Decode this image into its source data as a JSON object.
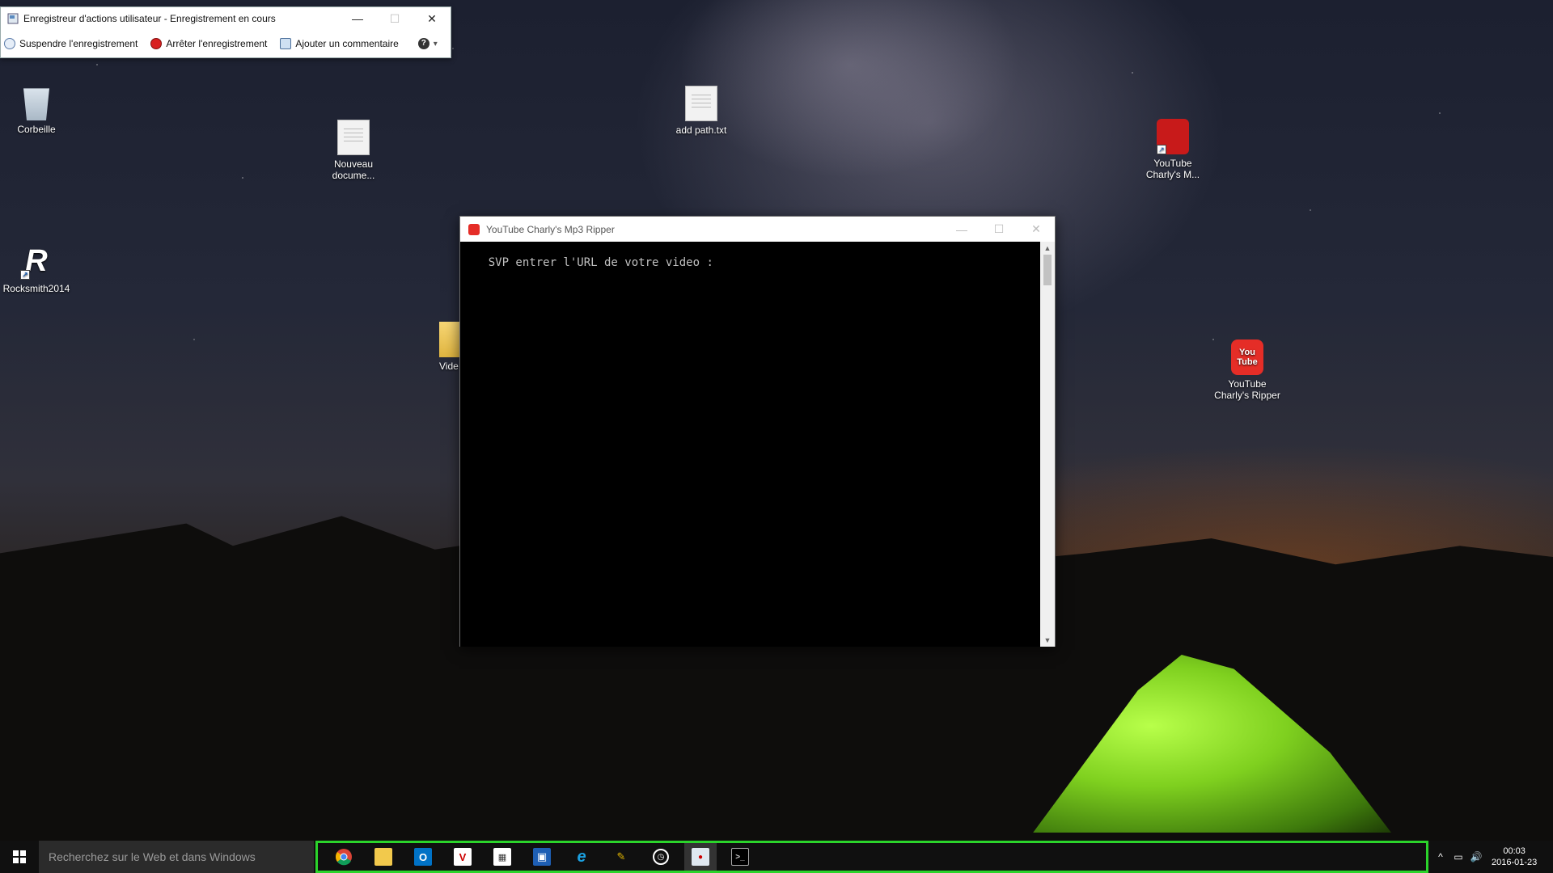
{
  "psr": {
    "title": "Enregistreur d'actions utilisateur - Enregistrement en cours",
    "pause_label": "Suspendre l'enregistrement",
    "stop_label": "Arrêter l'enregistrement",
    "comment_label": "Ajouter un commentaire",
    "help_glyph": "?",
    "dropdown_glyph": "▾"
  },
  "desktop": {
    "recycle_bin": "Corbeille",
    "new_doc": "Nouveau docume...",
    "add_path": "add path.txt",
    "yt_mp3": "YouTube Charly's M...",
    "rocksmith": "Rocksmith2014",
    "video_folder": "Vide",
    "yt_ripper": "YouTube Charly's Ripper",
    "yt_logo_text": "You Tube",
    "shortcut_glyph": "↗"
  },
  "console": {
    "title": "YouTube Charly's Mp3 Ripper",
    "prompt": "SVP entrer l'URL de votre video :"
  },
  "window_controls": {
    "minimize": "—",
    "maximize": "☐",
    "close": "✕"
  },
  "taskbar": {
    "search_placeholder": "Recherchez sur le Web et dans Windows",
    "clock_time": "00:03",
    "clock_date": "2016-01-23"
  },
  "colors": {
    "highlight": "#2bd42b",
    "youtube_red": "#e52d27"
  }
}
